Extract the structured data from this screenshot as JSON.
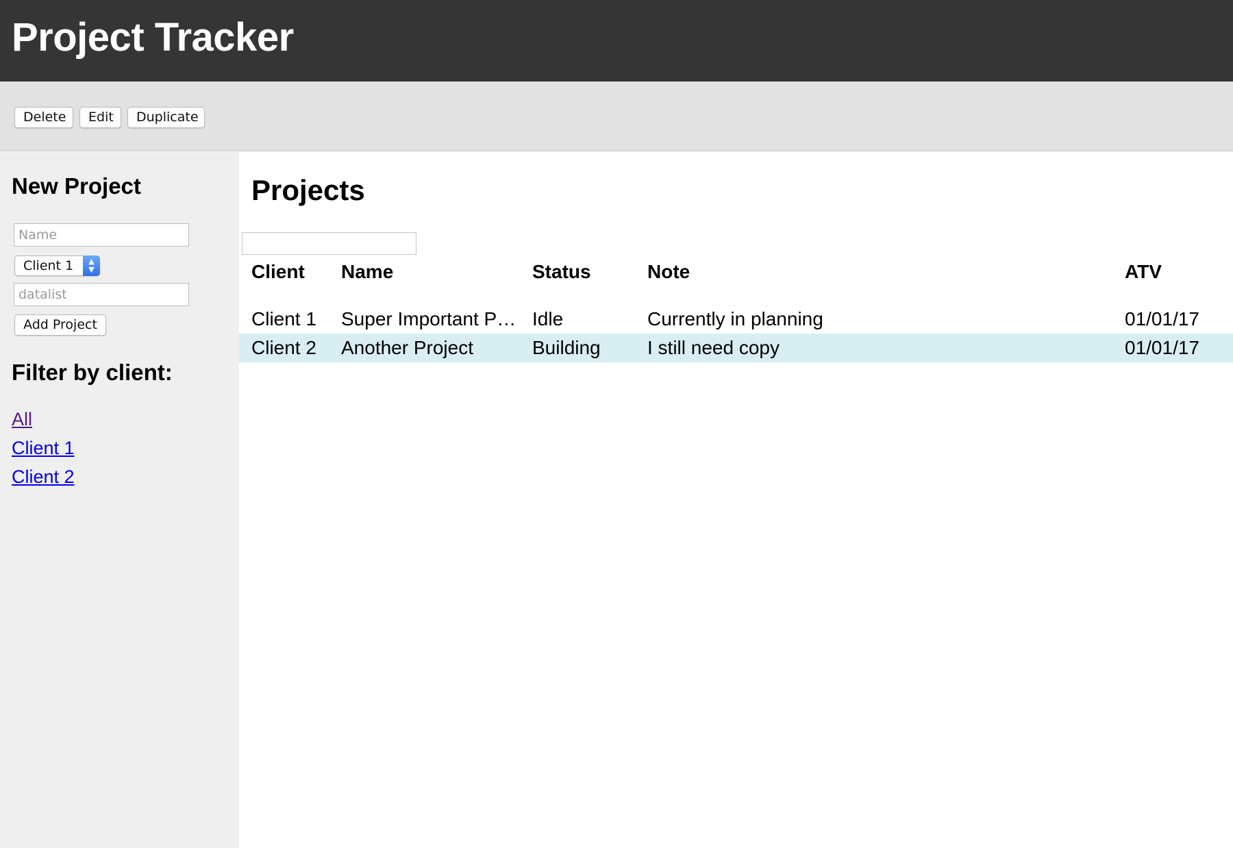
{
  "header": {
    "title": "Project Tracker"
  },
  "toolbar": {
    "delete_label": "Delete",
    "edit_label": "Edit",
    "duplicate_label": "Duplicate"
  },
  "sidebar": {
    "new_project_heading": "New Project",
    "name_placeholder": "Name",
    "client_select_value": "Client 1",
    "datalist_placeholder": "datalist",
    "add_project_label": "Add Project",
    "filter_heading": "Filter by client:",
    "filters": [
      "All",
      "Client 1",
      "Client 2"
    ]
  },
  "main": {
    "title": "Projects",
    "search_value": "",
    "columns": [
      "Client",
      "Name",
      "Status",
      "Note",
      "ATV"
    ],
    "rows": [
      {
        "client": "Client 1",
        "name": "Super Important P…",
        "status": "Idle",
        "note": "Currently in planning",
        "atv": "01/01/17",
        "selected": false
      },
      {
        "client": "Client 2",
        "name": "Another Project",
        "status": "Building",
        "note": "I still need copy",
        "atv": "01/01/17",
        "selected": true
      }
    ]
  },
  "colors": {
    "header_bg": "#353535",
    "toolbar_bg": "#e2e2e2",
    "sidebar_bg": "#efefef",
    "selected_row_bg": "#d9eef3",
    "link": "#0000ee",
    "visited_link": "#551a8b"
  }
}
